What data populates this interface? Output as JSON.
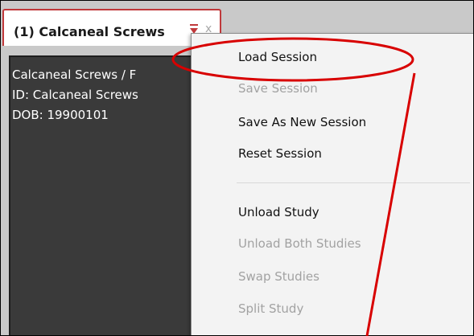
{
  "tab": {
    "title": "(1) Calcaneal Screws",
    "dropdown_icon": "triangle-down-icon",
    "close_label": "x"
  },
  "patient": {
    "name_sex": "Calcaneal Screws / F",
    "id": "ID: Calcaneal Screws",
    "dob": "DOB: 19900101"
  },
  "menu": {
    "load_session": "Load Session",
    "save_session": "Save Session",
    "save_as_new_session": "Save As New Session",
    "reset_session": "Reset Session",
    "unload_study": "Unload Study",
    "unload_both_studies": "Unload Both Studies",
    "swap_studies": "Swap Studies",
    "split_study": "Split Study"
  },
  "colors": {
    "annotation_red": "#d80000",
    "tab_border": "#c0393b",
    "viewer_bg": "#3a3a3a",
    "menu_bg": "#f3f3f3",
    "disabled_text": "#a2a2a2"
  }
}
